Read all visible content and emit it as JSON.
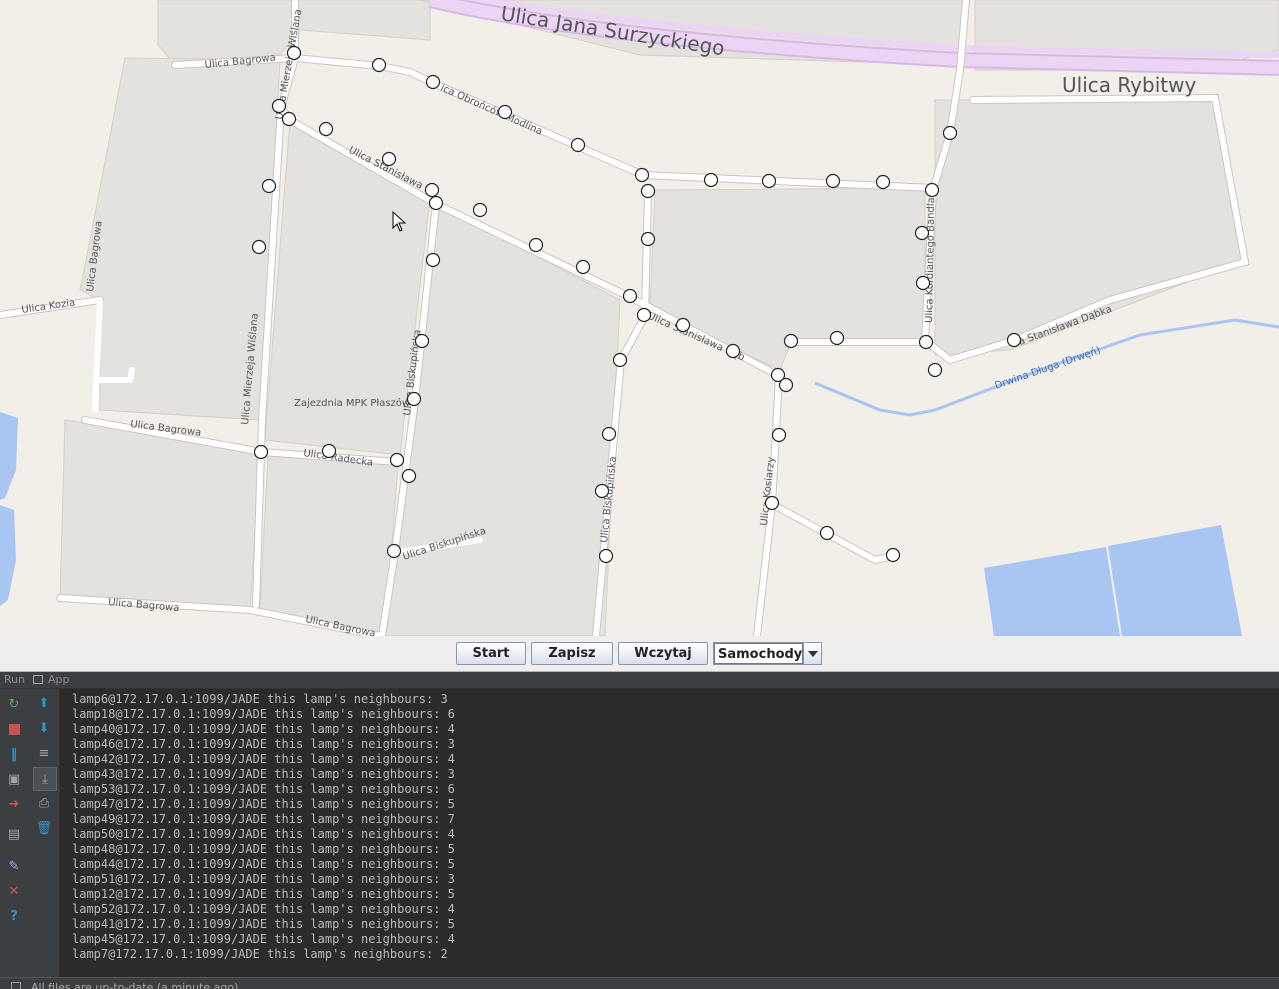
{
  "map": {
    "big_labels": [
      "Ulica Jana Surzyckiego",
      "Ulica Rybitwy"
    ],
    "street_labels": [
      "Ulica Bagrowa",
      "Ulica Mierzeja Wiślana",
      "ica Obrońców Modlina",
      "Ulica Stanisława Dą",
      "Ulica Bagrowa",
      "Ulica Kozia",
      "Ulica Mierzeja Wiślana",
      "Ulica Bagrowa",
      "Ulica Radecka",
      "Ulica Biskupińska",
      "Ulica Biskupińska",
      "Ulica Bagrowa",
      "Ulica Bagrowa",
      "Ulica Biskupińska",
      "Ulica Stanisława Dąb",
      "Ulica Kosiarzy",
      "Ulica Kordiantego Bandla",
      "a Stanisława Dąbka"
    ],
    "place_label": "Zajezdnia MPK Płaszów",
    "water_label": "Drwina Długa (Drwęń)",
    "lamp_count": 52
  },
  "toolbar": {
    "start_label": "Start",
    "save_label": "Zapisz",
    "load_label": "Wczytaj",
    "mode_selected": "Samochody"
  },
  "run_panel": {
    "run_label": "Run",
    "app_label": "App"
  },
  "console_lines": [
    "lamp6@172.17.0.1:1099/JADE this lamp's neighbours: 3",
    "lamp18@172.17.0.1:1099/JADE this lamp's neighbours: 6",
    "lamp40@172.17.0.1:1099/JADE this lamp's neighbours: 4",
    "lamp46@172.17.0.1:1099/JADE this lamp's neighbours: 3",
    "lamp42@172.17.0.1:1099/JADE this lamp's neighbours: 4",
    "lamp43@172.17.0.1:1099/JADE this lamp's neighbours: 3",
    "lamp53@172.17.0.1:1099/JADE this lamp's neighbours: 6",
    "lamp47@172.17.0.1:1099/JADE this lamp's neighbours: 5",
    "lamp49@172.17.0.1:1099/JADE this lamp's neighbours: 7",
    "lamp50@172.17.0.1:1099/JADE this lamp's neighbours: 4",
    "lamp48@172.17.0.1:1099/JADE this lamp's neighbours: 5",
    "lamp44@172.17.0.1:1099/JADE this lamp's neighbours: 5",
    "lamp51@172.17.0.1:1099/JADE this lamp's neighbours: 3",
    "lamp12@172.17.0.1:1099/JADE this lamp's neighbours: 5",
    "lamp52@172.17.0.1:1099/JADE this lamp's neighbours: 4",
    "lamp41@172.17.0.1:1099/JADE this lamp's neighbours: 5",
    "lamp45@172.17.0.1:1099/JADE this lamp's neighbours: 4",
    "lamp7@172.17.0.1:1099/JADE this lamp's neighbours: 2"
  ],
  "status_text": "All files are up-to-date (a minute ago)",
  "colors": {
    "map_background": "#f2efe9",
    "block_fill": "#e4e2de",
    "road": "#ffffff",
    "highway": "#e8c8f0",
    "water": "#a9c5f2",
    "console_bg": "#2b2b2b",
    "console_text": "#bbbbbb"
  }
}
